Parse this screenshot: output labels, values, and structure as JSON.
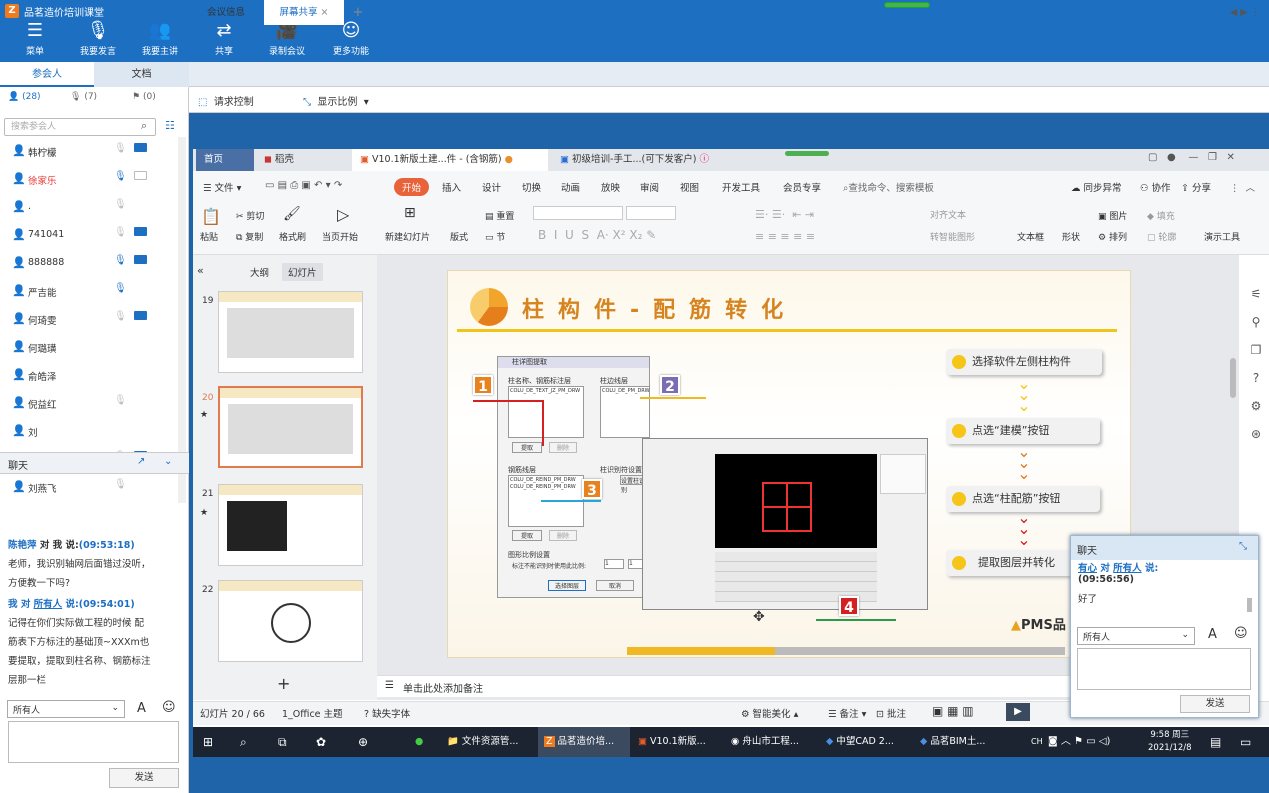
{
  "app": {
    "title": "品茗造价培训课堂",
    "logo": "Z"
  },
  "toolbar": [
    {
      "label": "菜单",
      "icon": "menu-icon",
      "glyph": "☰"
    },
    {
      "label": "我要发言",
      "icon": "mic-icon",
      "glyph": "🎙"
    },
    {
      "label": "我要主讲",
      "icon": "presenter-icon",
      "glyph": "👥"
    },
    {
      "label": "共享",
      "icon": "share-icon",
      "glyph": "⇄"
    },
    {
      "label": "录制会议",
      "icon": "record-icon",
      "glyph": "🎥"
    },
    {
      "label": "更多功能",
      "icon": "more-icon",
      "glyph": "☺"
    }
  ],
  "left_tabs": {
    "participants": "参会人",
    "docs": "文档"
  },
  "counts": {
    "people": "(28)",
    "mics": "(7)",
    "hands": "(0)"
  },
  "search_placeholder": "搜索参会人",
  "participants": [
    {
      "name": "韩柠檬",
      "mic": "off",
      "cam": "on",
      "highlight": false
    },
    {
      "name": "徐家乐",
      "mic": "on",
      "cam": "off",
      "highlight": true
    },
    {
      "name": ".",
      "mic": "off",
      "cam": "none",
      "highlight": false
    },
    {
      "name": "741041",
      "mic": "off",
      "cam": "on",
      "highlight": false
    },
    {
      "name": "888888",
      "mic": "on",
      "cam": "on",
      "highlight": false
    },
    {
      "name": "严吉能",
      "mic": "on",
      "cam": "none",
      "highlight": false
    },
    {
      "name": "何琦雯",
      "mic": "off",
      "cam": "on",
      "highlight": false
    },
    {
      "name": "何璐璜",
      "mic": "none",
      "cam": "none",
      "highlight": false
    },
    {
      "name": "俞皓泽",
      "mic": "none",
      "cam": "none",
      "highlight": false
    },
    {
      "name": "倪益红",
      "mic": "off",
      "cam": "none",
      "highlight": false
    },
    {
      "name": "刘",
      "mic": "none",
      "cam": "none",
      "highlight": false
    },
    {
      "name": "刘昱",
      "mic": "off",
      "cam": "on",
      "highlight": false
    },
    {
      "name": "刘燕飞",
      "mic": "off",
      "cam": "none",
      "highlight": false
    }
  ],
  "chat": {
    "title": "聊天",
    "msg1_sender": "陈艳萍",
    "msg1_mid": " 对 我 说:",
    "msg1_time": "(09:53:18)",
    "msg1_text": [
      "老师，我识别轴网后面错过没听，",
      "方便教一下吗?"
    ],
    "msg2_sender": "我",
    "msg2_mid": " 对 ",
    "msg2_to": "所有人",
    "msg2_say": " 说:",
    "msg2_time": "(09:54:01)",
    "msg2_text": [
      "记得在你们实际做工程的时候 配",
      "筋表下方标注的基础顶~XXXm也",
      "要提取，提取到柱名称、钢筋标注",
      "层那一栏"
    ],
    "target": "所有人",
    "send": "发送"
  },
  "meeting_tabs": {
    "info": "会议信息",
    "share": "屏幕共享",
    "plus": "+"
  },
  "share_toolbar": {
    "request": "请求控制",
    "ratio": "显示比例"
  },
  "wps": {
    "tabs": [
      "首页",
      "稻壳",
      "V10.1新版土建...件 - (含钢筋)",
      "初级培训-手工...(可下发客户)"
    ],
    "menus": [
      "文件",
      "开始",
      "插入",
      "设计",
      "切换",
      "动画",
      "放映",
      "审阅",
      "视图",
      "开发工具",
      "会员专享"
    ],
    "search": "查找命令、搜索模板",
    "right_menu": [
      "同步异常",
      "协作",
      "分享"
    ],
    "ribbon": [
      "粘贴",
      "剪切",
      "复制",
      "格式刷",
      "当页开始",
      "新建幻灯片",
      "版式",
      "重置",
      "节",
      "文本框",
      "形状",
      "图片",
      "排列",
      "填充",
      "轮廓",
      "演示工具",
      "对齐文本",
      "转智能图形"
    ],
    "panel_tabs": [
      "大纲",
      "幻灯片"
    ],
    "thumb_nums": [
      "19",
      "20",
      "21",
      "22"
    ],
    "notes": "单击此处添加备注",
    "status": {
      "slide": "幻灯片 20 / 66",
      "theme": "1_Office 主题",
      "font": "缺失字体",
      "beautify": "智能美化",
      "notes": "备注",
      "comment": "批注"
    }
  },
  "slide": {
    "title": "柱构件-配筋转化",
    "steps": [
      "选择软件左侧柱构件",
      "点选“建模”按钮",
      "点选“柱配筋”按钮",
      "提取图层并转化"
    ],
    "nums": [
      "1",
      "2",
      "3",
      "4"
    ],
    "dlg_title": "柱详图提取",
    "dlg_name_label": "柱名称、钢筋标注层",
    "dlg_edge_label": "柱边线层",
    "dlg_rebar_label": "钢筋线层",
    "dlg_color_label": "柱识别符设置",
    "dlg_layer1": "COLU_DE_TEXT_JZ_PM_DRW",
    "dlg_layer2": "COLU_DE_PM_DRW",
    "dlg_layer3": "COLU_DE_REIND_PM_DRW",
    "dlg_layer4": "COLU_DE_REIND_PM_DRW",
    "dlg_btn_extract": "提取",
    "dlg_btn_delete": "删除",
    "dlg_btn_setting": "设置柱识别",
    "dlg_scale_title": "图形比例设置",
    "dlg_scale_label": "标注不能识别时使用此比例:",
    "dlg_scale_v1": "1",
    "dlg_scale_v2": "1",
    "dlg_ok": "选择图层",
    "dlg_cancel": "取消",
    "logo": "PMS品"
  },
  "popchat": {
    "title": "聊天",
    "sender": "有心",
    "mid": " 对 ",
    "to": "所有人",
    "time": "(09:56:56)",
    "text": "好了",
    "target": "所有人",
    "send": "发送"
  },
  "taskbar": {
    "items": [
      "文件资源管...",
      "品茗造价培...",
      "V10.1新版...",
      "舟山市工程...",
      "中望CAD 2...",
      "品茗BIM土..."
    ],
    "time": "9:58 周三",
    "date": "2021/12/8",
    "lang": "CH"
  }
}
